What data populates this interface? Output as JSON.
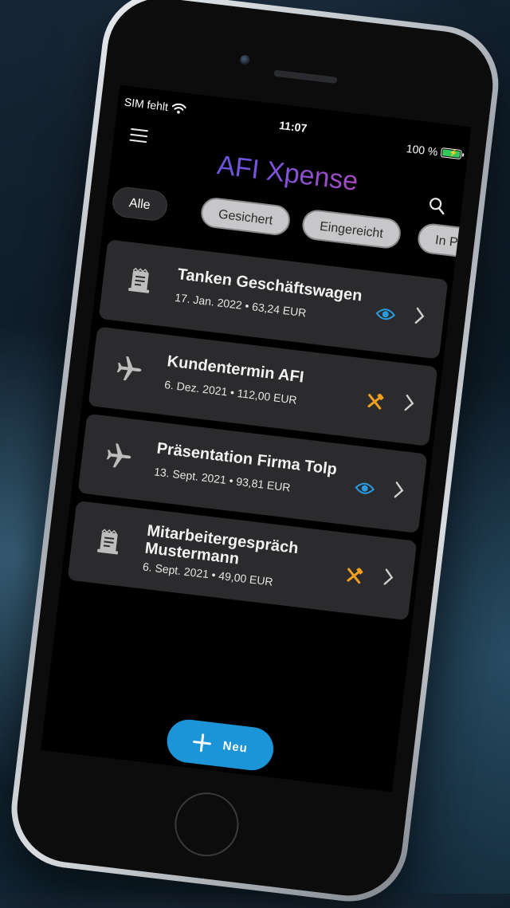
{
  "status_bar": {
    "carrier": "SIM fehlt",
    "time": "11:07",
    "battery_text": "100 %",
    "battery_level": 1.0,
    "battery_color": "#34c759"
  },
  "header": {
    "title": "AFI Xpense",
    "menu_icon": "hamburger-menu-icon",
    "search_icon": "search-icon",
    "title_gradient": [
      "#3b57d6",
      "#7e54dc",
      "#d2409a"
    ]
  },
  "filters": [
    {
      "label": "Alle",
      "active": true
    },
    {
      "label": "Gesichert",
      "active": false
    },
    {
      "label": "Eingereicht",
      "active": false
    },
    {
      "label": "In P",
      "active": false
    }
  ],
  "expenses": [
    {
      "title": "Tanken Geschäftswagen",
      "subtitle": "17. Jan. 2022 • 63,24 EUR",
      "type_icon": "receipt-icon",
      "status_icon": "eye-icon",
      "status_color": "#2a9be0"
    },
    {
      "title": "Kundentermin AFI",
      "subtitle": "6. Dez. 2021 • 112,00 EUR",
      "type_icon": "airplane-icon",
      "status_icon": "tools-icon",
      "status_color": "#f0a020"
    },
    {
      "title": "Präsentation Firma Tolp",
      "subtitle": "13. Sept. 2021 • 93,81 EUR",
      "type_icon": "airplane-icon",
      "status_icon": "eye-icon",
      "status_color": "#2a9be0"
    },
    {
      "title": "Mitarbeitergespräch Mustermann",
      "subtitle": "6. Sept. 2021 • 49,00 EUR",
      "type_icon": "receipt-icon",
      "status_icon": "tools-icon",
      "status_color": "#f0a020"
    }
  ],
  "fab": {
    "label": "Neu",
    "icon": "plus-icon",
    "color": "#1b95d8"
  }
}
